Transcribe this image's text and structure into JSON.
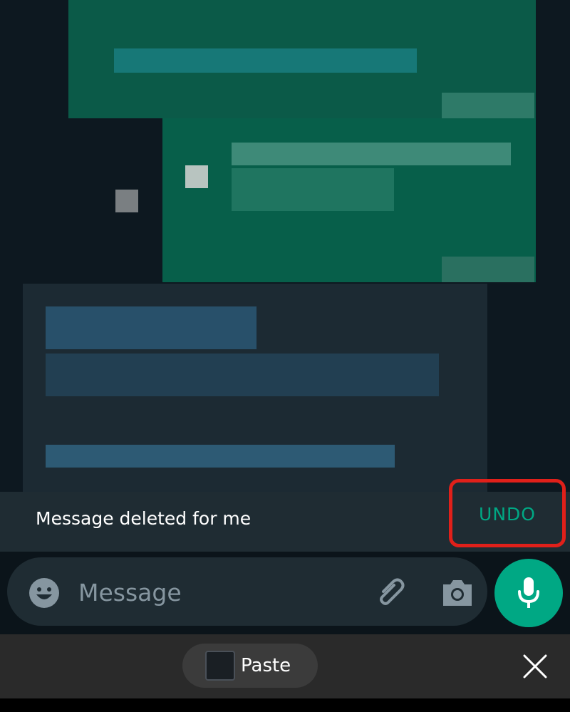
{
  "snackbar": {
    "message": "Message deleted for me",
    "undo_label": "UNDO",
    "accent_color": "#00a884",
    "highlight_color": "#e0201a"
  },
  "composer": {
    "placeholder": "Message",
    "icons": [
      "emoji-icon",
      "attach-icon",
      "camera-icon",
      "mic-icon"
    ]
  },
  "clipboard": {
    "paste_label": "Paste",
    "close_icon": "close-icon"
  }
}
